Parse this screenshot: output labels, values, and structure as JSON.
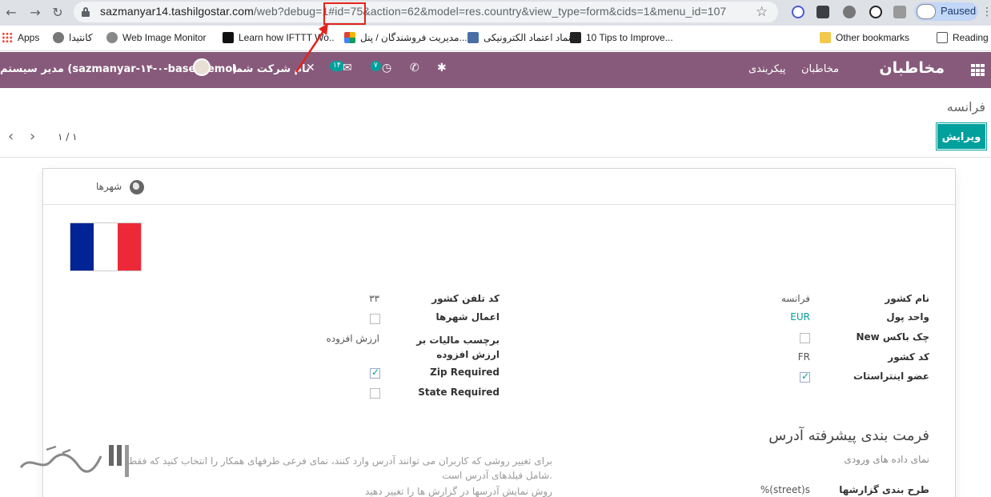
{
  "browser": {
    "url_main": "sazmanyar14.tashilgostar.com",
    "url_rest": "/web?debug=1#id=75&action=62&model=res.country&view_type=form&cids=1&menu_id=107",
    "profile_label": "Paused",
    "bookmarks": [
      {
        "label": "Apps"
      },
      {
        "label": "كانتيدا"
      },
      {
        "label": "Web Image Monitor"
      },
      {
        "label": "Learn how IFTTT Wo..."
      },
      {
        "label": "مدیریت فروشندگان / پنل..."
      },
      {
        "label": "نماد اعتماد الکترونیکی"
      },
      {
        "label": "10 Tips to Improve..."
      },
      {
        "label": "Other bookmarks"
      },
      {
        "label": "Reading list"
      }
    ]
  },
  "navbar": {
    "brand": "مخاطبان",
    "menu": [
      "مخاطبان",
      "پیکربندی"
    ],
    "company": "نام شرکت شما",
    "user": "مدیر سیستم (sazmanyar-۱۴-۰-base-demo)",
    "messages_count": "۱۴",
    "activities_count": "۷"
  },
  "control_panel": {
    "breadcrumb": "فرانسه",
    "edit_label": "ویرایش",
    "pager": "۱ / ۱"
  },
  "form": {
    "smart_button": "شهرها",
    "flag_colors": [
      "#002395",
      "#ffffff",
      "#ed2939"
    ],
    "right_group": {
      "country_name_label": "نام کشور",
      "country_name": "فرانسه",
      "currency_label": "واحد پول",
      "currency": "EUR",
      "new_checkbox_label": "New چک باکس",
      "new_checkbox": false,
      "code_label": "کد کشور",
      "code": "FR",
      "intrastat_label": "عضو اینتراستات",
      "intrastat": true
    },
    "left_group": {
      "phone_code_label": "کد تلفن کشور",
      "phone_code": "۳۳",
      "state_enforce_label": "اعمال شهرها",
      "state_enforce": false,
      "vat_label_label": "برچسب مالیات بر ارزش افزوده",
      "vat_label": "ارزش افزوده",
      "zip_required_label": "Zip Required",
      "zip_required": true,
      "state_required_label": "State Required",
      "state_required": false
    },
    "address_section": {
      "title": "فرمت بندی پیشرفته آدرس",
      "subtitle": "نمای داده های ورودی",
      "help_line1": "برای تغییر روشی که کاربران می توانند آدرس وارد کنند، نمای فرعی طرفهای همکار را انتخاب کنید که فقط",
      "help_line2": "شامل فیلدهای آدرس است.",
      "help_line3": "روش نمایش آدرسها در گزارش ها را تغییر دهید",
      "report_layout_label": "طرح بندی گزارشها",
      "report_layout": "%(street)s"
    }
  }
}
